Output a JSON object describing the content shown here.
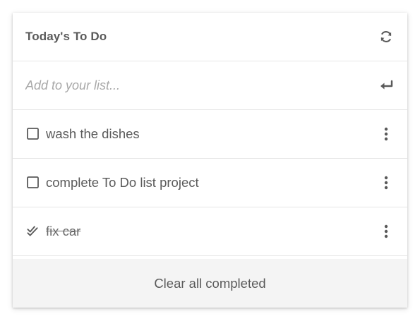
{
  "header": {
    "title": "Today's To Do",
    "refresh_icon": "refresh-icon"
  },
  "add_item": {
    "placeholder": "Add to your list...",
    "value": "",
    "submit_icon": "enter-return-icon"
  },
  "tasks": [
    {
      "label": "wash the dishes",
      "completed": false,
      "menu_icon": "more-vertical-icon"
    },
    {
      "label": "complete To Do list project",
      "completed": false,
      "menu_icon": "more-vertical-icon"
    },
    {
      "label": "fix car",
      "completed": true,
      "menu_icon": "more-vertical-icon"
    }
  ],
  "footer": {
    "clear_label": "Clear all completed"
  },
  "colors": {
    "text": "#5a5a5a",
    "placeholder": "#a8a8a8",
    "footer_bg": "#f4f4f4",
    "divider": "#e6e6e6"
  }
}
